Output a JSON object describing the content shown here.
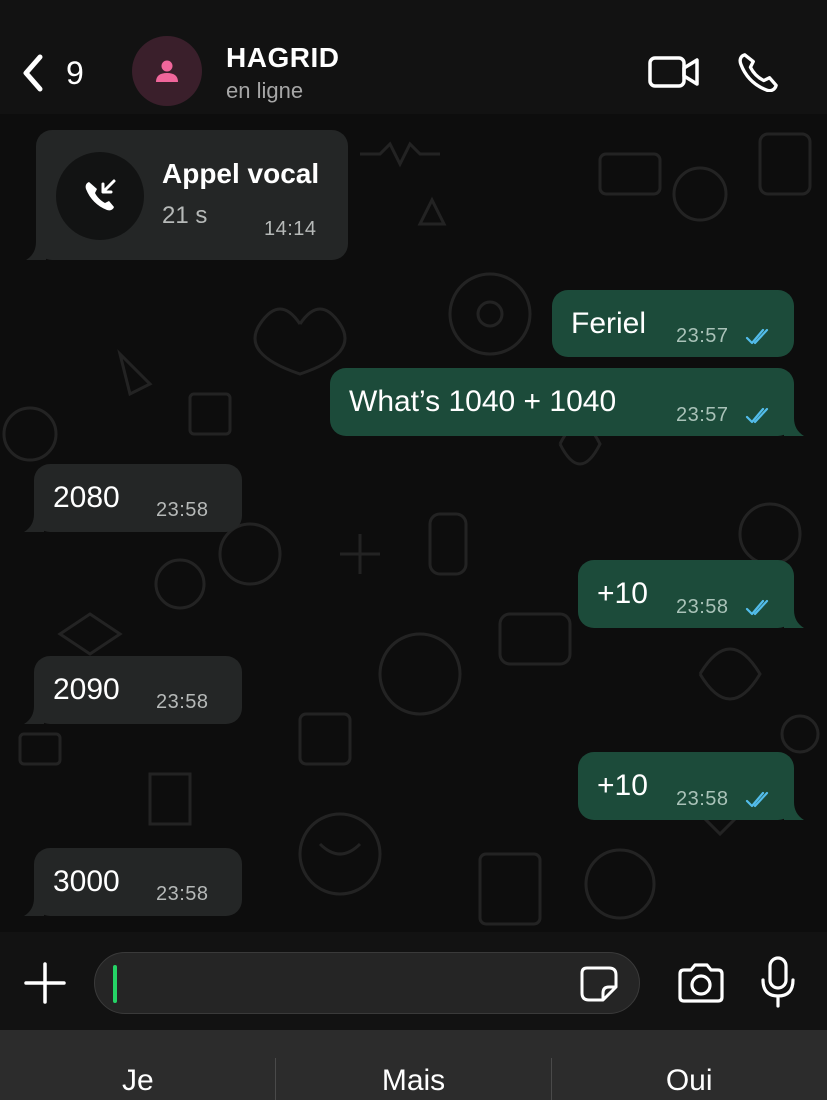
{
  "header": {
    "back_count": "9",
    "contact_name": "HAGRID",
    "contact_status": "en ligne"
  },
  "call": {
    "title": "Appel vocal",
    "duration": "21 s",
    "time": "14:14"
  },
  "messages": [
    {
      "direction": "out",
      "text": "Feriel",
      "time": "23:57",
      "status": "read"
    },
    {
      "direction": "out",
      "text": "What’s 1040 + 1040",
      "time": "23:57",
      "status": "read"
    },
    {
      "direction": "in",
      "text": "2080",
      "time": "23:58"
    },
    {
      "direction": "out",
      "text": "+10",
      "time": "23:58",
      "status": "read"
    },
    {
      "direction": "in",
      "text": "2090",
      "time": "23:58"
    },
    {
      "direction": "out",
      "text": "+10",
      "time": "23:58",
      "status": "read"
    },
    {
      "direction": "in",
      "text": "3000",
      "time": "23:58"
    }
  ],
  "composer": {
    "value": "",
    "placeholder": ""
  },
  "suggestions": [
    "Je",
    "Mais",
    "Oui"
  ],
  "icons": {
    "back": "chevron-left-icon",
    "video": "video-call-icon",
    "phone": "phone-icon",
    "incoming_call": "incoming-call-icon",
    "plus": "plus-icon",
    "sticker": "sticker-icon",
    "camera": "camera-icon",
    "mic": "microphone-icon",
    "read_receipt": "double-check-icon"
  },
  "colors": {
    "outgoing_bubble": "#1c4b3a",
    "incoming_bubble": "#242626",
    "read_tick": "#53bdeb",
    "caret": "#25d366"
  }
}
